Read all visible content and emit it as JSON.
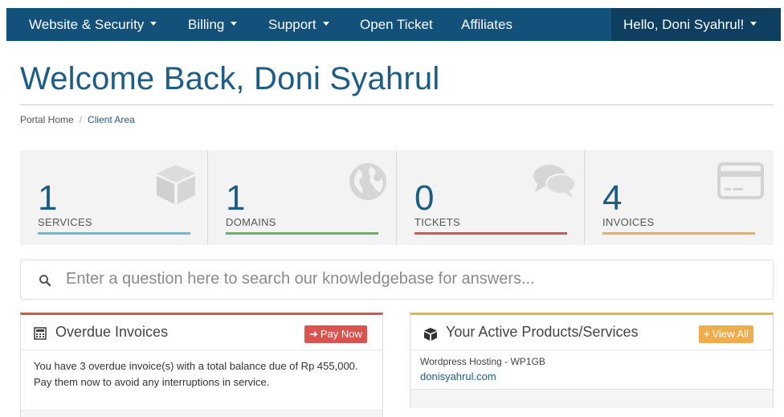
{
  "navbar": {
    "items": [
      {
        "label": "Website & Security",
        "dropdown": true
      },
      {
        "label": "Billing",
        "dropdown": true
      },
      {
        "label": "Support",
        "dropdown": true
      },
      {
        "label": "Open Ticket",
        "dropdown": false
      },
      {
        "label": "Affiliates",
        "dropdown": false
      }
    ],
    "user_label": "Hello, Doni Syahrul!"
  },
  "page": {
    "title": "Welcome Back, Doni Syahrul"
  },
  "breadcrumb": {
    "home": "Portal Home",
    "separator": "/",
    "current": "Client Area"
  },
  "tiles": [
    {
      "count": "1",
      "label": "SERVICES",
      "accent": "#5bc0de",
      "icon": "cube-icon"
    },
    {
      "count": "1",
      "label": "DOMAINS",
      "accent": "#5cb85c",
      "icon": "globe-icon"
    },
    {
      "count": "0",
      "label": "TICKETS",
      "accent": "#d9534f",
      "icon": "comments-icon"
    },
    {
      "count": "4",
      "label": "INVOICES",
      "accent": "#f0ad4e",
      "icon": "credit-card-icon"
    }
  ],
  "search": {
    "placeholder": "Enter a question here to search our knowledgebase for answers..."
  },
  "overdue_panel": {
    "title": "Overdue Invoices",
    "button": "Pay Now",
    "message": "You have 3 overdue invoice(s) with a total balance due of Rp 455,000. Pay them now to avoid any interruptions in service."
  },
  "active_panel": {
    "title": "Your Active Products/Services",
    "button": "View All",
    "product_name": "Wordpress Hosting - WP1GB",
    "product_domain": "donisyahrul.com"
  },
  "colors": {
    "navbar": "#13507a",
    "brand_text": "#1d5c85",
    "danger": "#d9534f",
    "warning": "#f0ad4e"
  }
}
